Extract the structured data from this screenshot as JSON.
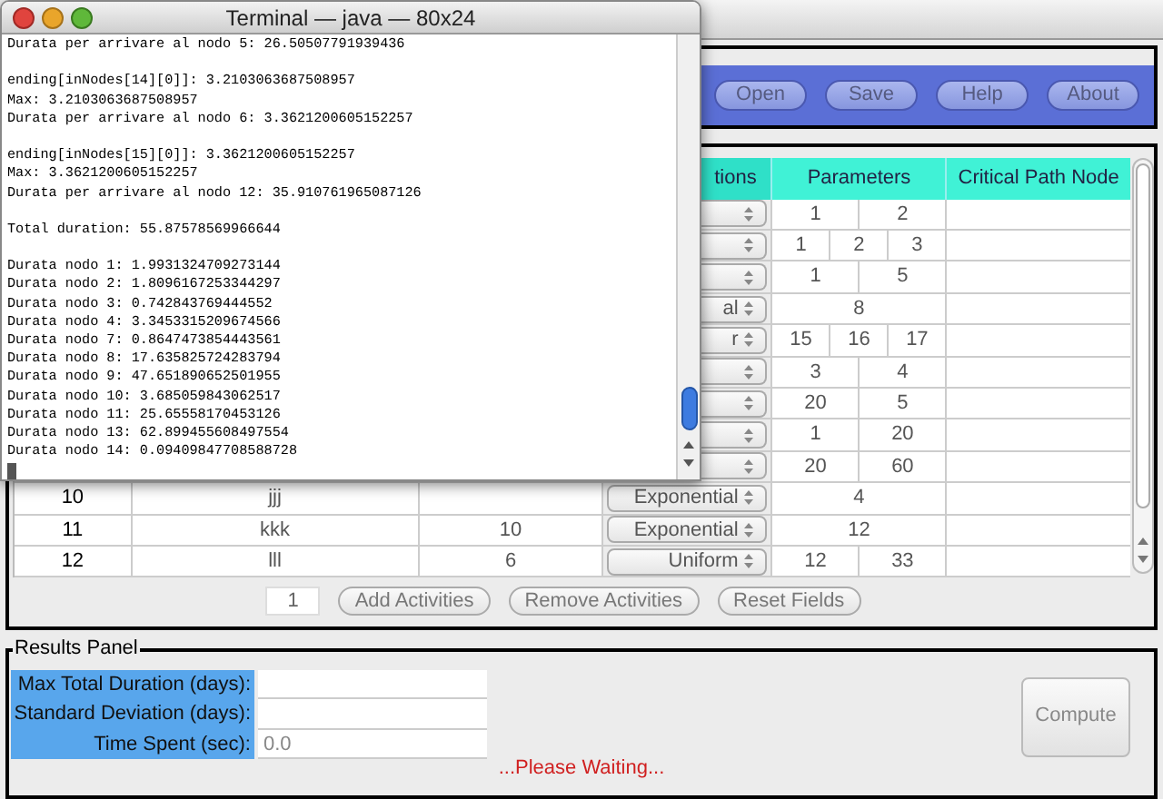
{
  "terminal": {
    "title": "Terminal — java — 80x24",
    "blocks": [
      [
        "Durata per arrivare al nodo 5: 26.50507791939436"
      ],
      [
        "ending[inNodes[14][0]]: 3.2103063687508957",
        "Max: 3.2103063687508957",
        "Durata per arrivare al nodo 6: 3.3621200605152257"
      ],
      [
        "ending[inNodes[15][0]]: 3.3621200605152257",
        "Max: 3.3621200605152257",
        "Durata per arrivare al nodo 12: 35.910761965087126"
      ],
      [
        "Total duration: 55.87578569966644"
      ],
      [
        "Durata nodo 1: 1.9931324709273144",
        "Durata nodo 2: 1.8096167253344297",
        "Durata nodo 3: 0.742843769444552",
        "Durata nodo 4: 3.3453315209674566",
        "Durata nodo 7: 0.8647473854443561",
        "Durata nodo 8: 17.635825724283794",
        "Durata nodo 9: 47.651890652501955",
        "Durata nodo 10: 3.685059843062517",
        "Durata nodo 11: 25.65558170453126",
        "Durata nodo 13: 62.899455608497554",
        "Durata nodo 14: 0.09409847708588728"
      ]
    ]
  },
  "toolbar": {
    "buttons": [
      "Open",
      "Save",
      "Help",
      "About"
    ]
  },
  "table": {
    "columns": [
      "tions",
      "Parameters",
      "Critical Path Node"
    ],
    "rows": [
      {
        "parameters": [
          "1",
          "2"
        ]
      },
      {
        "parameters": [
          "1",
          "2",
          "3"
        ]
      },
      {
        "parameters": [
          "1",
          "5"
        ]
      },
      {
        "parameters": [
          "8"
        ],
        "distribution": "al"
      },
      {
        "parameters": [
          "15",
          "16",
          "17"
        ],
        "distribution": "r"
      },
      {
        "parameters": [
          "3",
          "4"
        ]
      },
      {
        "parameters": [
          "20",
          "5"
        ]
      },
      {
        "parameters": [
          "1",
          "20"
        ]
      },
      {
        "parameters": [
          "20",
          "60"
        ]
      },
      {
        "number": "10",
        "name": "jjj",
        "distribution": "Exponential",
        "parameters": [
          "4"
        ]
      },
      {
        "number": "11",
        "name": "kkk",
        "duration": "10",
        "distribution": "Exponential",
        "parameters": [
          "12"
        ]
      },
      {
        "number": "12",
        "name": "lll",
        "duration": "6",
        "distribution": "Uniform",
        "parameters": [
          "12",
          "33"
        ]
      }
    ]
  },
  "activity_controls": {
    "count": "1",
    "buttons": [
      "Add Activities",
      "Remove Activities",
      "Reset Fields"
    ]
  },
  "results": {
    "title": "Results Panel",
    "fields": [
      {
        "label": "Max Total Duration (days):"
      },
      {
        "label": "Standard Deviation (days):"
      },
      {
        "label": "Time Spent (sec):",
        "value": "0.0"
      }
    ],
    "compute_button": "Compute",
    "status": "...Please Waiting..."
  }
}
